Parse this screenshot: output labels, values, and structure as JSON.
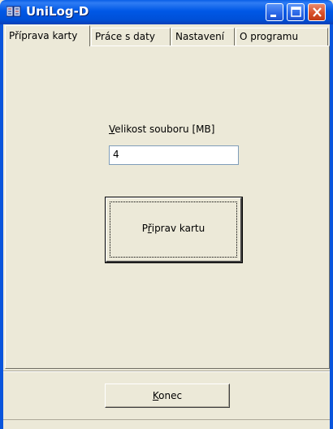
{
  "window": {
    "title": "UniLog-D",
    "icon": "unilog-app-icon"
  },
  "tabs": [
    {
      "label": "Příprava karty",
      "active": true
    },
    {
      "label": "Práce s daty",
      "active": false
    },
    {
      "label": "Nastavení",
      "active": false
    },
    {
      "label": "O programu",
      "active": false
    }
  ],
  "prep": {
    "size_label_key": "V",
    "size_label_rest": "elikost souboru [MB]",
    "size_value": "4",
    "prepare_button_pre": "P",
    "prepare_button_key": "ř",
    "prepare_button_post": "iprav kartu"
  },
  "footer": {
    "close_button_key": "K",
    "close_button_rest": "onec"
  },
  "colors": {
    "face": "#ece9d8",
    "title_blue": "#0058e6",
    "close_red": "#d9502a"
  }
}
